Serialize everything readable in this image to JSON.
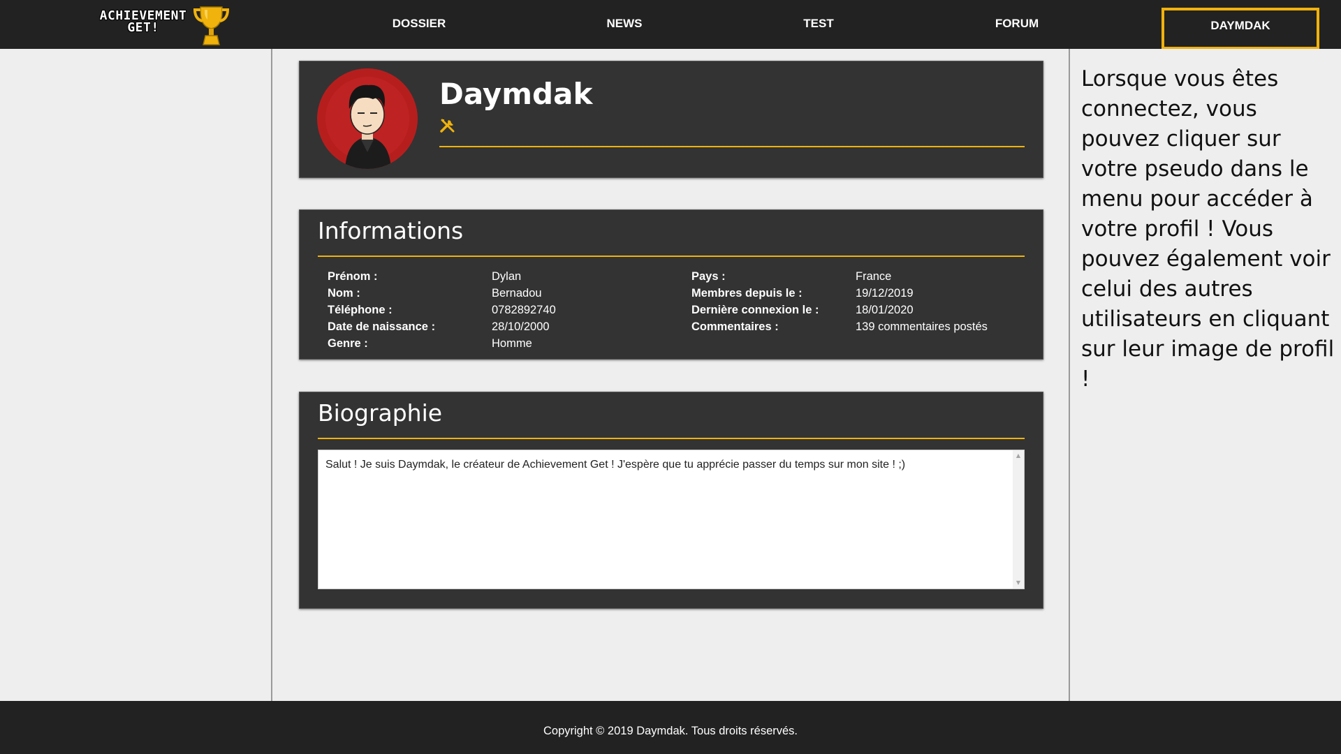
{
  "navbar": {
    "logo_line1": "ACHIEVEMENT",
    "logo_line2": "GET!",
    "items": [
      "DOSSIER",
      "NEWS",
      "TEST",
      "FORUM"
    ],
    "user_label": "DAYMDAK",
    "accent_color": "#f0b20c"
  },
  "profile": {
    "name": "Daymdak",
    "role_icon": "tools-icon"
  },
  "informations": {
    "title": "Informations",
    "left": [
      {
        "label": "Prénom :",
        "value": "Dylan"
      },
      {
        "label": "Nom :",
        "value": "Bernadou"
      },
      {
        "label": "Téléphone :",
        "value": "0782892740"
      },
      {
        "label": "Date de naissance :",
        "value": "28/10/2000"
      },
      {
        "label": "Genre :",
        "value": "Homme"
      }
    ],
    "right": [
      {
        "label": "Pays :",
        "value": "France"
      },
      {
        "label": "Membres depuis le :",
        "value": "19/12/2019"
      },
      {
        "label": "Dernière connexion le :",
        "value": "18/01/2020"
      },
      {
        "label": "Commentaires :",
        "value": "139 commentaires postés"
      }
    ]
  },
  "biographie": {
    "title": "Biographie",
    "text": "Salut ! Je suis Daymdak, le créateur de Achievement Get ! J'espère que tu apprécie passer du temps sur mon site ! ;)"
  },
  "help": {
    "text": "Lorsque vous êtes connectez, vous pouvez cliquer sur votre pseudo dans le menu pour accéder à votre profil ! Vous pouvez également voir celui des autres utilisateurs en cliquant sur leur image de profil !"
  },
  "footer": {
    "text": "Copyright © 2019 Daymdak. Tous droits réservés."
  }
}
